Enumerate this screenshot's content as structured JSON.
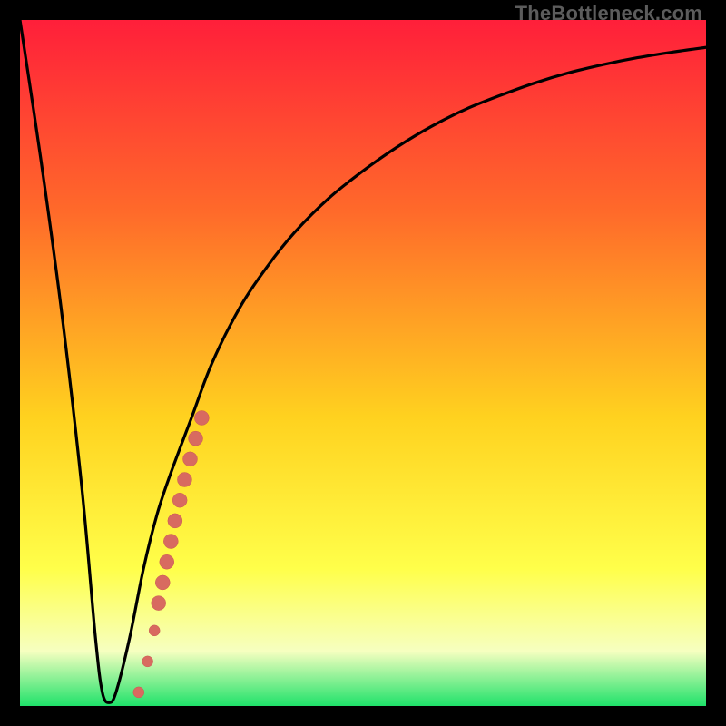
{
  "watermark": "TheBottleneck.com",
  "colors": {
    "frame": "#000000",
    "gradient_top": "#ff1f3a",
    "gradient_mid_upper": "#ff6a2a",
    "gradient_mid": "#ffd21f",
    "gradient_mid_lower": "#ffff4a",
    "gradient_pale": "#f6ffc0",
    "gradient_bottom": "#1fe26a",
    "curve": "#000000",
    "marker_fill": "#d86a60",
    "marker_stroke": "#c95b52"
  },
  "chart_data": {
    "type": "line",
    "title": "",
    "xlabel": "",
    "ylabel": "",
    "xlim": [
      0,
      100
    ],
    "ylim": [
      0,
      100
    ],
    "series": [
      {
        "name": "bottleneck-curve",
        "x": [
          0,
          3,
          6,
          9,
          11,
          12,
          13,
          14,
          16,
          18,
          20,
          22,
          25,
          28,
          32,
          36,
          40,
          45,
          50,
          55,
          60,
          65,
          70,
          75,
          80,
          85,
          90,
          95,
          100
        ],
        "y": [
          100,
          80,
          58,
          32,
          10,
          2,
          0.5,
          2,
          10,
          20,
          28,
          34,
          42,
          50,
          58,
          64,
          69,
          74,
          78,
          81.5,
          84.5,
          87,
          89,
          90.8,
          92.3,
          93.5,
          94.5,
          95.3,
          96
        ]
      }
    ],
    "markers": {
      "name": "highlighted-range",
      "points": [
        {
          "x": 17.3,
          "y": 2.0,
          "r": 6
        },
        {
          "x": 18.6,
          "y": 6.5,
          "r": 6
        },
        {
          "x": 19.6,
          "y": 11.0,
          "r": 6
        },
        {
          "x": 20.2,
          "y": 15.0,
          "r": 8
        },
        {
          "x": 20.8,
          "y": 18.0,
          "r": 8
        },
        {
          "x": 21.4,
          "y": 21.0,
          "r": 8
        },
        {
          "x": 22.0,
          "y": 24.0,
          "r": 8
        },
        {
          "x": 22.6,
          "y": 27.0,
          "r": 8
        },
        {
          "x": 23.3,
          "y": 30.0,
          "r": 8
        },
        {
          "x": 24.0,
          "y": 33.0,
          "r": 8
        },
        {
          "x": 24.8,
          "y": 36.0,
          "r": 8
        },
        {
          "x": 25.6,
          "y": 39.0,
          "r": 8
        },
        {
          "x": 26.5,
          "y": 42.0,
          "r": 8
        }
      ]
    }
  }
}
